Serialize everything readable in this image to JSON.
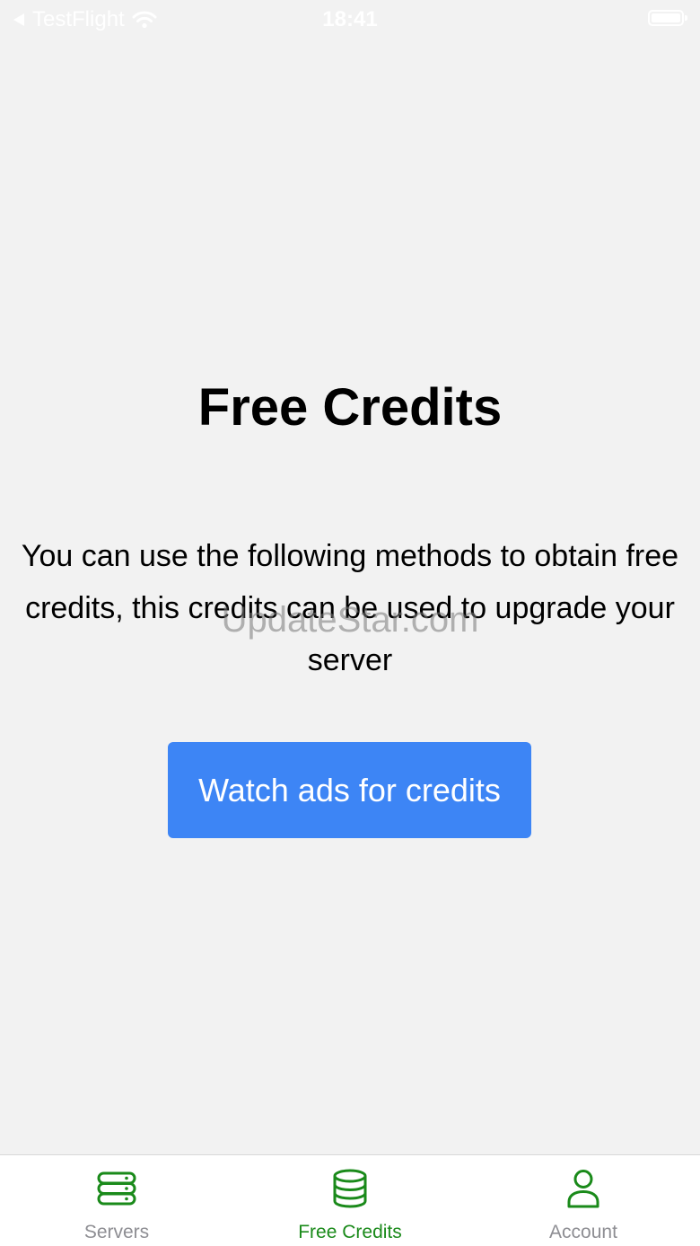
{
  "status_bar": {
    "back_app": "TestFlight",
    "time": "18:41"
  },
  "main": {
    "title": "Free Credits",
    "description": "You can use the following methods to obtain free credits, this credits can be used to upgrade your server",
    "watch_ads_label": "Watch ads for credits",
    "watermark": "UpdateStar.com"
  },
  "tab_bar": {
    "tabs": [
      {
        "label": "Servers",
        "icon": "server-icon",
        "active": false
      },
      {
        "label": "Free Credits",
        "icon": "coins-database-icon",
        "active": true
      },
      {
        "label": "Account",
        "icon": "person-icon",
        "active": false
      }
    ],
    "active_color": "#1a8a1a",
    "inactive_text_color": "#8e8e93"
  },
  "colors": {
    "background": "#f2f2f2",
    "button": "#3d85f5",
    "icon_green": "#1a8a1a"
  }
}
